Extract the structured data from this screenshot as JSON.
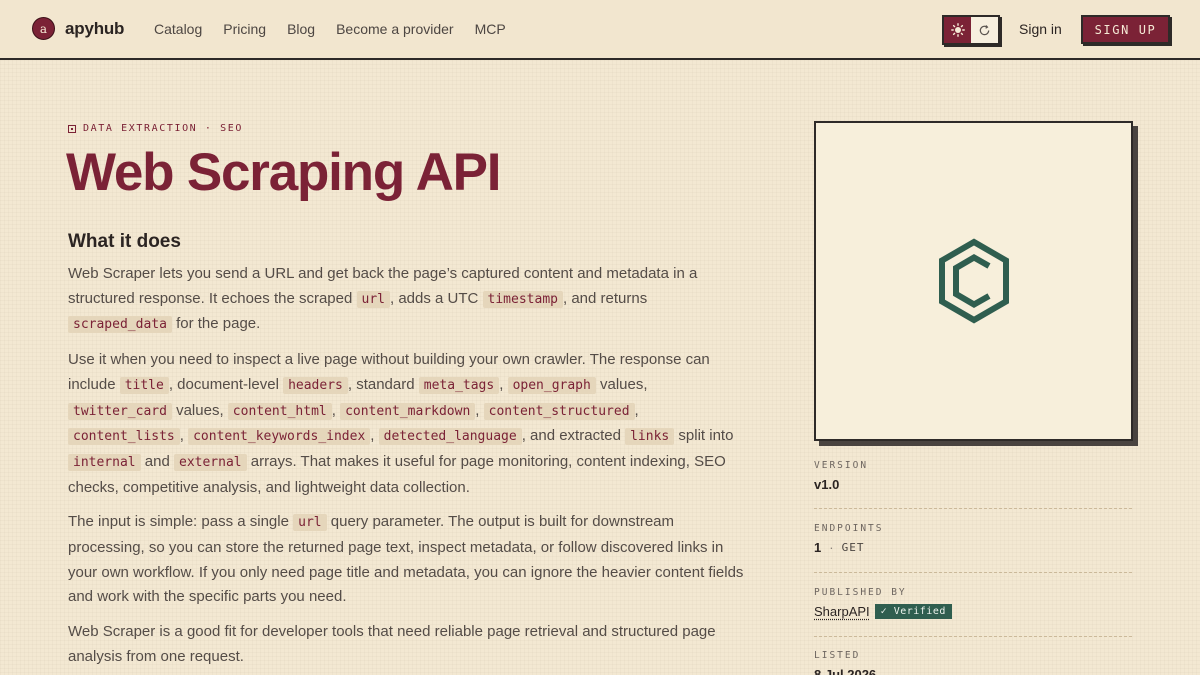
{
  "header": {
    "logo_letter": "a",
    "brand": "apyhub",
    "nav": [
      "Catalog",
      "Pricing",
      "Blog",
      "Become a provider",
      "MCP"
    ],
    "sign_in": "Sign in",
    "sign_up": "SIGN UP"
  },
  "main": {
    "eyebrow": "DATA EXTRACTION · SEO",
    "title": "Web Scraping API",
    "section_title": "What it does",
    "p1": [
      "Web Scraper lets you send a URL and get back the page’s captured content and metadata in a structured response. It echoes the scraped ",
      "url",
      ", adds a UTC ",
      "timestamp",
      ", and returns ",
      "scraped_data",
      " for the page."
    ],
    "p2": [
      "Use it when you need to inspect a live page without building your own crawler. The response can include ",
      "title",
      ", document-level ",
      "headers",
      ", standard ",
      "meta_tags",
      ", ",
      "open_graph",
      " values, ",
      "twitter_card",
      " values, ",
      "content_html",
      ", ",
      "content_markdown",
      ", ",
      "content_structured",
      ", ",
      "content_lists",
      ", ",
      "content_keywords_index",
      ", ",
      "detected_language",
      ", and extracted ",
      "links",
      " split into ",
      "internal",
      " and ",
      "external",
      " arrays. That makes it useful for page monitoring, content indexing, SEO checks, competitive analysis, and lightweight data collection."
    ],
    "p3": [
      "The input is simple: pass a single ",
      "url",
      " query parameter. The output is built for downstream processing, so you can store the returned page text, inspect metadata, or follow discovered links in your own workflow. If you only need page title and metadata, you can ignore the heavier content fields and work with the specific parts you need."
    ],
    "p4": [
      "Web Scraper is a good fit for developer tools that need reliable page retrieval and structured page analysis from one request."
    ]
  },
  "sidebar": {
    "version_label": "VERSION",
    "version": "v1.0",
    "endpoints_label": "ENDPOINTS",
    "endpoints_count": "1",
    "endpoints_dot": "·",
    "endpoints_method": "GET",
    "published_label": "PUBLISHED BY",
    "publisher": "SharpAPI",
    "verified": "✓ Verified",
    "listed_label": "LISTED",
    "listed": "8 Jul 2026"
  },
  "colors": {
    "accent": "#7b2236",
    "background": "#f3e8d2",
    "verified": "#2f5e4f",
    "logo_icon": "#2f5e4f"
  },
  "icons": [
    "sun-icon",
    "refresh-icon",
    "hexagon-logo-icon"
  ]
}
